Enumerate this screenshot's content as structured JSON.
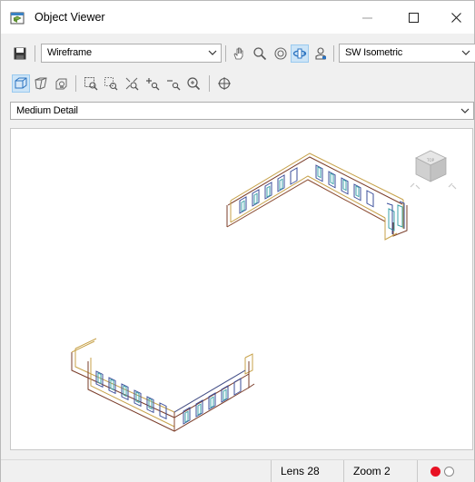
{
  "window": {
    "title": "Object Viewer",
    "icon": "object-viewer-app-icon"
  },
  "toolbar": {
    "display_mode": "Wireframe",
    "view_direction": "SW Isometric",
    "detail_level": "Medium Detail",
    "accent": "#3b82c4"
  },
  "status": {
    "lens": "Lens 28",
    "zoom": "Zoom 2",
    "record_color": "#e81123"
  }
}
